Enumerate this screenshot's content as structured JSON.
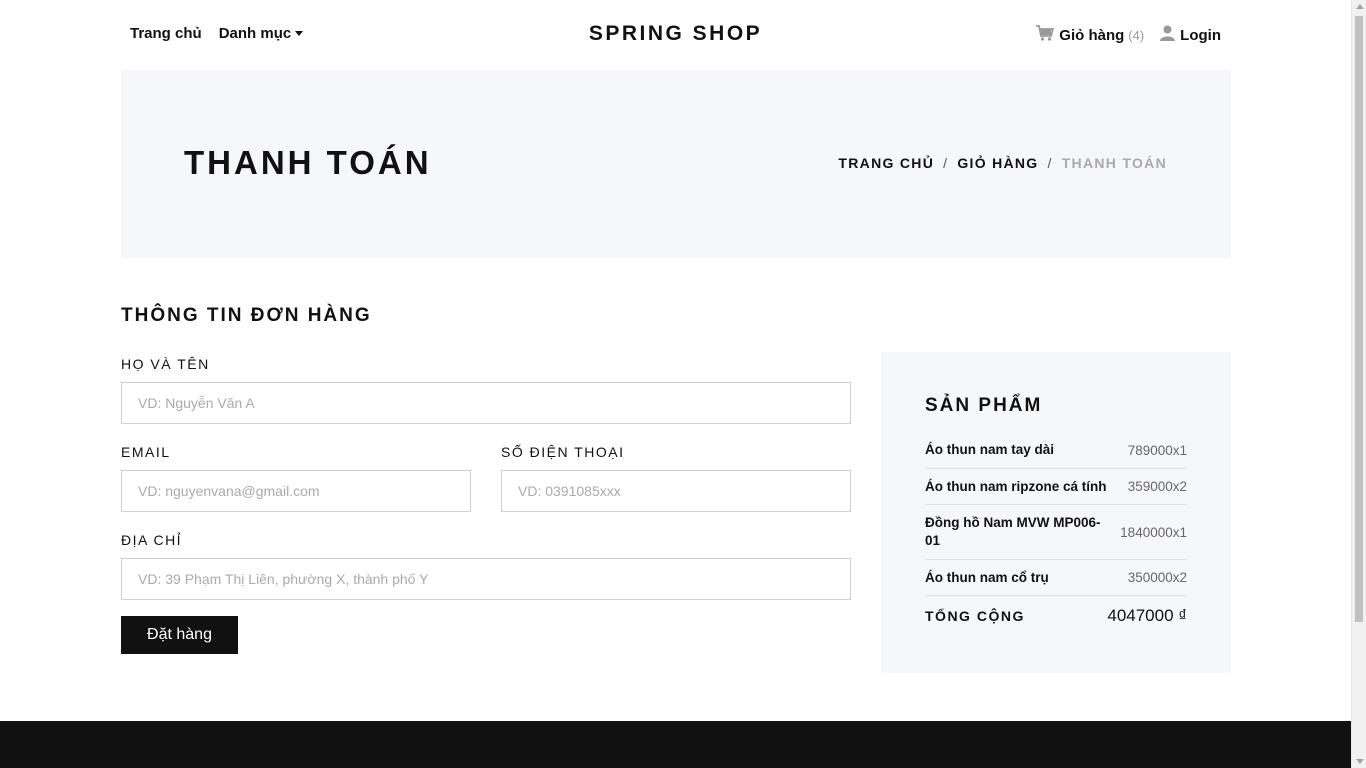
{
  "header": {
    "nav": {
      "home": "Trang chủ",
      "category": "Danh mục"
    },
    "brand": "SPRING SHOP",
    "cart": {
      "label": "Giỏ hàng",
      "count": "(4)"
    },
    "login": "Login"
  },
  "hero": {
    "title": "THANH TOÁN",
    "breadcrumb": {
      "home": "TRANG CHỦ",
      "cart": "GIỎ HÀNG",
      "current": "THANH TOÁN",
      "separator": "/"
    }
  },
  "form": {
    "title": "THÔNG TIN ĐƠN HÀNG",
    "name": {
      "label": "HỌ VÀ TÊN",
      "placeholder": "VD: Nguyễn Văn A"
    },
    "email": {
      "label": "EMAIL",
      "placeholder": "VD: nguyenvana@gmail.com"
    },
    "phone": {
      "label": "SỐ ĐIỆN THOẠI",
      "placeholder": "VD: 0391085xxx"
    },
    "address": {
      "label": "ĐỊA CHỈ",
      "placeholder": "VD: 39 Phạm Thị Liên, phường X, thành phố Y"
    },
    "submit": "Đặt hàng"
  },
  "summary": {
    "title": "SẢN PHẨM",
    "items": [
      {
        "name": "Áo thun nam tay dài",
        "price": "789000x1"
      },
      {
        "name": "Áo thun nam ripzone cá tính",
        "price": "359000x2"
      },
      {
        "name": "Đồng hồ Nam MVW MP006-01",
        "price": "1840000x1"
      },
      {
        "name": "Áo thun nam cổ trụ",
        "price": "350000x2"
      }
    ],
    "total_label": "TỔNG CỘNG",
    "total_value": "4047000 ₫"
  },
  "colors": {
    "dark": "#111111",
    "hero_bg": "#f6f7f9",
    "muted": "#aaaaaa"
  }
}
